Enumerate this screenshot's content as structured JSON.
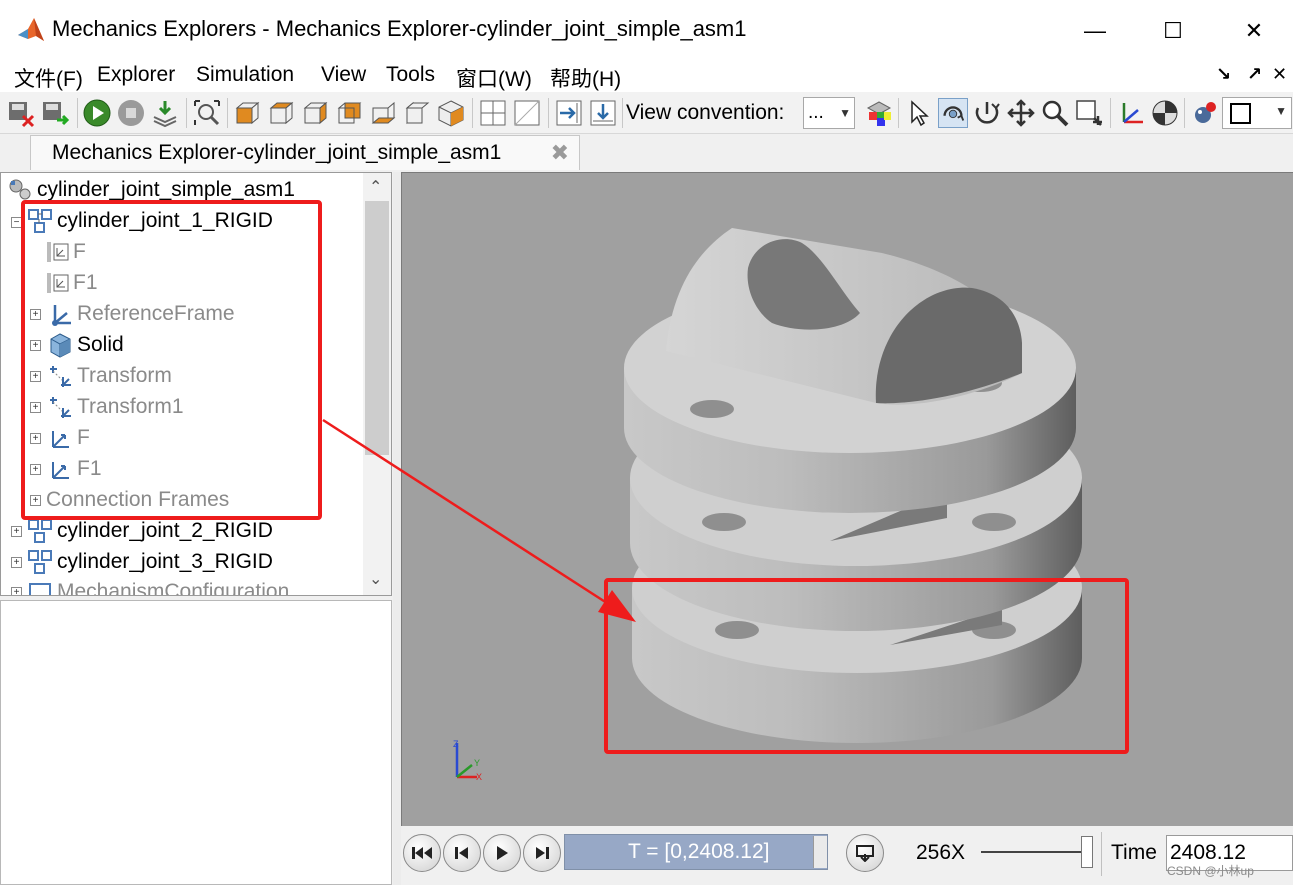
{
  "window": {
    "title": "Mechanics Explorers - Mechanics Explorer-cylinder_joint_simple_asm1",
    "controls": {
      "minimize": "—",
      "maximize": "☐",
      "close": "✕"
    }
  },
  "menu": {
    "items": [
      "文件(F)",
      "Explorer",
      "Simulation",
      "View",
      "Tools",
      "窗口(W)",
      "帮助(H)"
    ],
    "right": [
      "↘",
      "↗",
      "✕"
    ]
  },
  "toolbar": {
    "view_convention_label": "View convention:",
    "view_convention_value": "..."
  },
  "tab": {
    "label": "Mechanics Explorer-cylinder_joint_simple_asm1",
    "close": "✖"
  },
  "tree": {
    "root": "cylinder_joint_simple_asm1",
    "items": [
      {
        "label": "cylinder_joint_1_RIGID"
      },
      {
        "label": "F"
      },
      {
        "label": "F1"
      },
      {
        "label": "ReferenceFrame"
      },
      {
        "label": "Solid"
      },
      {
        "label": "Transform"
      },
      {
        "label": "Transform1"
      },
      {
        "label": "F"
      },
      {
        "label": "F1"
      },
      {
        "label": "Connection Frames"
      },
      {
        "label": "cylinder_joint_2_RIGID"
      },
      {
        "label": "cylinder_joint_3_RIGID"
      },
      {
        "label": "MechanismConfiguration"
      }
    ]
  },
  "viewport": {
    "triad_labels": {
      "z": "Z",
      "y": "Y",
      "x": "X"
    }
  },
  "playback": {
    "time_range": "T = [0,2408.12]",
    "speed": "256X",
    "time_label": "Time",
    "time_value": "2408.12"
  },
  "watermark": "CSDN @小林up",
  "colors": {
    "annotation": "#ee1c1c",
    "viewport_bg": "#a0a0a0",
    "time_field_bg": "#97a8c6"
  }
}
